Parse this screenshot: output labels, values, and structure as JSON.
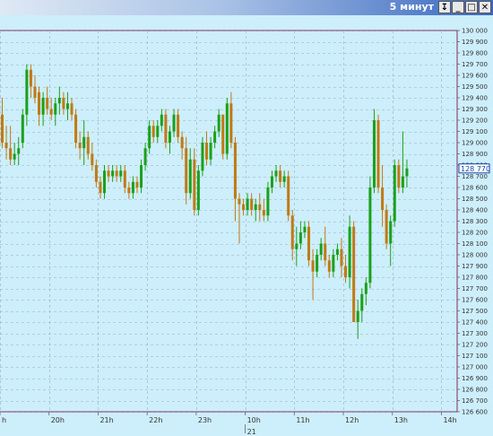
{
  "window": {
    "title": "5 минут",
    "buttons": {
      "restore": "↧",
      "minimize": "_",
      "maximize": "□",
      "close": "✕"
    }
  },
  "colors": {
    "background": "#cdeefb",
    "up": "#1aa11a",
    "down": "#c07a14",
    "grid": "#9ab0c0",
    "frame": "#7d2f6a"
  },
  "price_tag": "128 770",
  "chart_data": {
    "type": "candlestick",
    "ylim": [
      126600,
      130000
    ],
    "y_ticks": [
      126600,
      126700,
      126800,
      126900,
      127000,
      127100,
      127200,
      127300,
      127400,
      127500,
      127600,
      127700,
      127800,
      127900,
      128000,
      128100,
      128200,
      128300,
      128400,
      128500,
      128600,
      128700,
      128800,
      128900,
      129000,
      129100,
      129200,
      129300,
      129400,
      129500,
      129600,
      129700,
      129800,
      129900,
      130000
    ],
    "x_ticks": [
      {
        "label": "h",
        "x": 0
      },
      {
        "label": "20h",
        "x": 12
      },
      {
        "label": "21h",
        "x": 24
      },
      {
        "label": "22h",
        "x": 36
      },
      {
        "label": "23h",
        "x": 48
      },
      {
        "label": "10h",
        "x": 60
      },
      {
        "label": "11h",
        "x": 72
      },
      {
        "label": "12h",
        "x": 84
      },
      {
        "label": "13h",
        "x": 96
      },
      {
        "label": "14h",
        "x": 108
      }
    ],
    "date_label": "21",
    "current_price": 128770,
    "candles": [
      [
        129250,
        129400,
        128950,
        129000
      ],
      [
        129000,
        129150,
        128850,
        128950
      ],
      [
        128950,
        129150,
        128800,
        128850
      ],
      [
        128850,
        129000,
        128800,
        128900
      ],
      [
        128900,
        129050,
        128800,
        128950
      ],
      [
        129000,
        129300,
        128950,
        129250
      ],
      [
        129250,
        129700,
        129150,
        129650
      ],
      [
        129650,
        129700,
        129400,
        129500
      ],
      [
        129500,
        129600,
        129350,
        129400
      ],
      [
        129450,
        129500,
        129150,
        129250
      ],
      [
        129250,
        129450,
        129150,
        129400
      ],
      [
        129400,
        129500,
        129250,
        129300
      ],
      [
        129300,
        129400,
        129200,
        129250
      ],
      [
        129250,
        129400,
        129150,
        129350
      ],
      [
        129350,
        129500,
        129250,
        129400
      ],
      [
        129400,
        129450,
        129250,
        129300
      ],
      [
        129300,
        129450,
        129200,
        129350
      ],
      [
        129350,
        129400,
        129200,
        129250
      ],
      [
        129250,
        129300,
        128950,
        129000
      ],
      [
        129000,
        129100,
        128850,
        128950
      ],
      [
        128950,
        129200,
        128800,
        129050
      ],
      [
        129050,
        129100,
        128850,
        128900
      ],
      [
        128900,
        129000,
        128750,
        128800
      ],
      [
        128800,
        128850,
        128600,
        128650
      ],
      [
        128650,
        128700,
        128500,
        128550
      ],
      [
        128550,
        128800,
        128500,
        128750
      ],
      [
        128750,
        128800,
        128650,
        128700
      ],
      [
        128700,
        128800,
        128650,
        128750
      ],
      [
        128750,
        128800,
        128650,
        128700
      ],
      [
        128700,
        128800,
        128650,
        128750
      ],
      [
        128750,
        128800,
        128550,
        128600
      ],
      [
        128600,
        128650,
        128500,
        128550
      ],
      [
        128550,
        128700,
        128500,
        128650
      ],
      [
        128650,
        128700,
        128550,
        128600
      ],
      [
        128600,
        128850,
        128550,
        128800
      ],
      [
        128800,
        129000,
        128750,
        128950
      ],
      [
        128950,
        129200,
        128900,
        129150
      ],
      [
        129150,
        129200,
        129000,
        129050
      ],
      [
        129050,
        129200,
        129000,
        129150
      ],
      [
        129150,
        129300,
        129100,
        129250
      ],
      [
        129250,
        129300,
        128950,
        129000
      ],
      [
        129000,
        129150,
        128900,
        129100
      ],
      [
        129100,
        129300,
        129050,
        129250
      ],
      [
        129250,
        129300,
        129000,
        129050
      ],
      [
        129050,
        129100,
        128850,
        128950
      ],
      [
        128950,
        129050,
        128450,
        128550
      ],
      [
        128550,
        128950,
        128500,
        128850
      ],
      [
        128850,
        128950,
        128350,
        128400
      ],
      [
        128400,
        128800,
        128350,
        128750
      ],
      [
        128750,
        129050,
        128700,
        129000
      ],
      [
        129000,
        129100,
        128800,
        128850
      ],
      [
        128850,
        129050,
        128800,
        129000
      ],
      [
        129000,
        129150,
        128950,
        129100
      ],
      [
        129100,
        129300,
        129050,
        129250
      ],
      [
        129250,
        129250,
        128850,
        128900
      ],
      [
        128900,
        129400,
        128850,
        129350
      ],
      [
        129350,
        129450,
        128950,
        129000
      ],
      [
        129000,
        129050,
        128300,
        128500
      ],
      [
        128500,
        128550,
        128100,
        128450
      ],
      [
        128450,
        128500,
        128350,
        128400
      ],
      [
        128400,
        128550,
        128350,
        128500
      ],
      [
        128500,
        128550,
        128350,
        128400
      ],
      [
        128400,
        128500,
        128300,
        128450
      ],
      [
        128450,
        128550,
        128300,
        128400
      ],
      [
        128400,
        128500,
        128300,
        128350
      ],
      [
        128350,
        128650,
        128300,
        128600
      ],
      [
        128600,
        128750,
        128550,
        128700
      ],
      [
        128700,
        128800,
        128650,
        128750
      ],
      [
        128750,
        128800,
        128600,
        128650
      ],
      [
        128650,
        128750,
        128600,
        128700
      ],
      [
        128700,
        128750,
        128300,
        128350
      ],
      [
        128350,
        128400,
        127950,
        128050
      ],
      [
        128050,
        128250,
        127900,
        128100
      ],
      [
        128100,
        128300,
        128050,
        128200
      ],
      [
        128200,
        128300,
        128150,
        128250
      ],
      [
        128250,
        128300,
        127900,
        127950
      ],
      [
        127950,
        128050,
        127600,
        127850
      ],
      [
        127850,
        128050,
        127800,
        128000
      ],
      [
        128000,
        128150,
        127950,
        128100
      ],
      [
        128100,
        128250,
        127900,
        127950
      ],
      [
        127950,
        128000,
        127800,
        127850
      ],
      [
        127850,
        128050,
        127800,
        128000
      ],
      [
        128000,
        128100,
        127950,
        128050
      ],
      [
        128050,
        128150,
        127800,
        127900
      ],
      [
        127900,
        128000,
        127750,
        127800
      ],
      [
        127800,
        128350,
        127700,
        128250
      ],
      [
        128250,
        128300,
        127700,
        127400
      ],
      [
        127400,
        127600,
        127250,
        127500
      ],
      [
        127500,
        127700,
        127400,
        127650
      ],
      [
        127650,
        127800,
        127550,
        127750
      ],
      [
        127750,
        128700,
        127700,
        128600
      ],
      [
        128600,
        129300,
        128550,
        129200
      ],
      [
        129200,
        129250,
        128550,
        128600
      ],
      [
        128600,
        128800,
        128250,
        128400
      ],
      [
        128400,
        128450,
        128050,
        128100
      ],
      [
        128100,
        128350,
        127900,
        128300
      ],
      [
        128300,
        128850,
        128250,
        128800
      ],
      [
        128800,
        128850,
        128550,
        128600
      ],
      [
        128600,
        129100,
        128550,
        128700
      ],
      [
        128700,
        128850,
        128600,
        128770
      ]
    ]
  }
}
